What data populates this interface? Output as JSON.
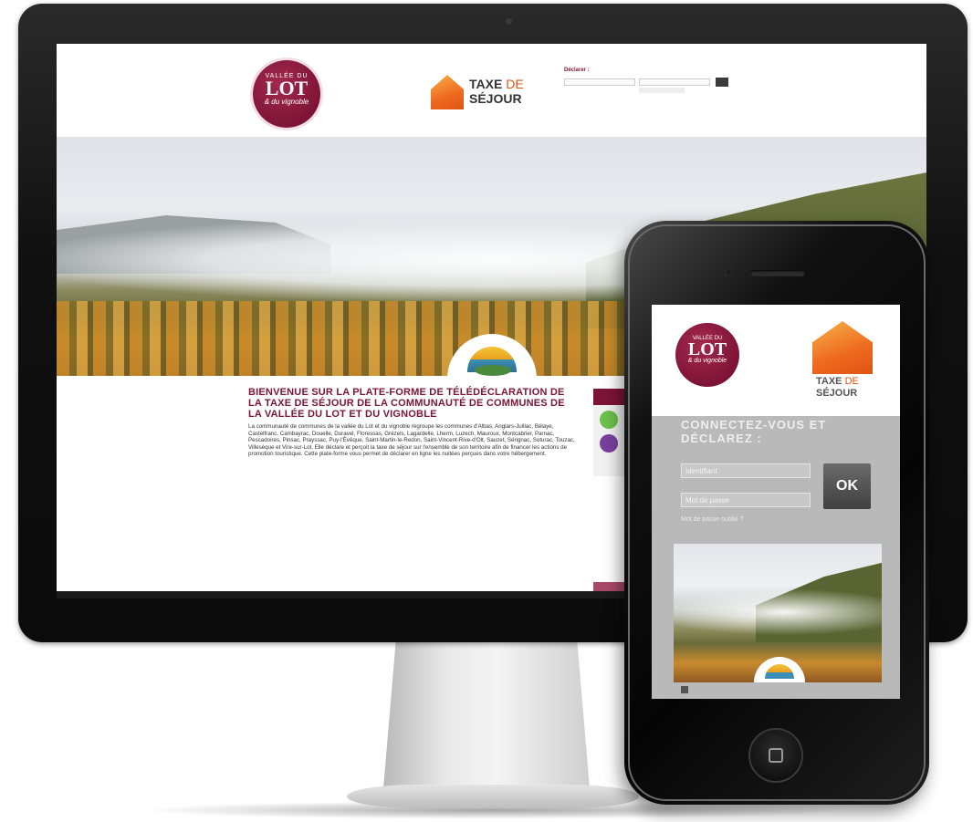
{
  "desktop": {
    "brand": {
      "seal_top": "VALLÉE DU",
      "seal_main": "LOT",
      "seal_sub": "& du vignoble"
    },
    "tax_logo": {
      "line1": "TAXE",
      "line1_accent": "DE",
      "line2": "SÉJOUR"
    },
    "login": {
      "label": "Déclarer :"
    },
    "title": "BIENVENUE SUR LA PLATE-FORME DE TÉLÉDÉCLARATION DE LA TAXE DE SÉJOUR DE LA COMMUNAUTÉ DE COMMUNES DE LA VALLÉE DU LOT ET DU VIGNOBLE",
    "body": "La communauté de communes de la vallée du Lot et du vignoble regroupe les communes d'Albas, Anglars-Juillac, Bélaye, Castelfranc, Cambayrac, Douelle, Duravel, Floressas, Grézels, Lagardelle, Lherm, Luzech, Mauroux, Montcabrier, Parnac, Pescadoires, Pinsac, Prayssac, Puy-l'Évêque, Saint-Martin-le-Redon, Saint-Vincent-Rive-d'Olt, Sauzet, Sérignac, Soturac, Touzac, Villesèque et Vire-sur-Lot. Elle déclare et perçoit la taxe de séjour sur l'ensemble de son territoire afin de financer les actions de promotion touristique. Cette plate-forme vous permet de déclarer en ligne les nuitées perçues dans votre hébergement."
  },
  "phone": {
    "brand": {
      "seal_top": "VALLÉE DU",
      "seal_main": "LOT",
      "seal_sub": "& du vignoble"
    },
    "tax_logo": {
      "line1": "TAXE",
      "line1_accent": "DE",
      "line2": "SÉJOUR"
    },
    "cta": "CONNECTEZ-VOUS ET DÉCLAREZ :",
    "login_placeholder": "Identifiant",
    "password_placeholder": "Mot de passe",
    "ok_label": "OK",
    "forgot_link": "Mot de passe oublié ?"
  },
  "icons": [
    "monitor-camera-icon",
    "phone-speaker-icon",
    "home-button-icon"
  ],
  "colors": {
    "brand": "#7d1437",
    "accent": "#ee6a1f",
    "ok_button": "#4a4a4a"
  }
}
